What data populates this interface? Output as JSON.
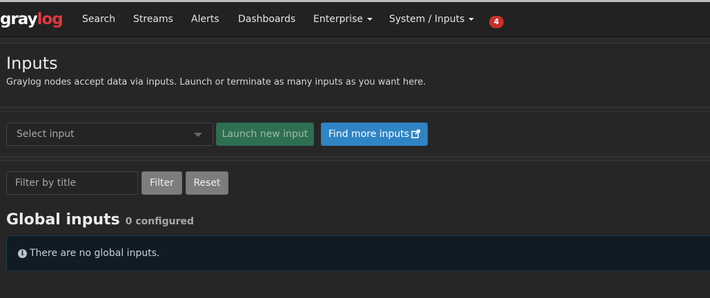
{
  "brand": {
    "part1": "gray",
    "part2": "log",
    "accent": "#e0393e"
  },
  "nav": {
    "items": [
      {
        "label": "Search"
      },
      {
        "label": "Streams"
      },
      {
        "label": "Alerts"
      },
      {
        "label": "Dashboards"
      },
      {
        "label": "Enterprise"
      },
      {
        "label": "System / Inputs"
      }
    ],
    "notification_count": "4"
  },
  "header": {
    "title": "Inputs",
    "description": "Graylog nodes accept data via inputs. Launch or terminate as many inputs as you want here."
  },
  "launch_bar": {
    "select_placeholder": "Select input",
    "launch_label": "Launch new input",
    "find_label": "Find more inputs"
  },
  "filter_bar": {
    "placeholder": "Filter by title",
    "filter_label": "Filter",
    "reset_label": "Reset"
  },
  "global_inputs": {
    "title": "Global inputs",
    "count_text": "0 configured",
    "empty_message": "There are no global inputs."
  }
}
